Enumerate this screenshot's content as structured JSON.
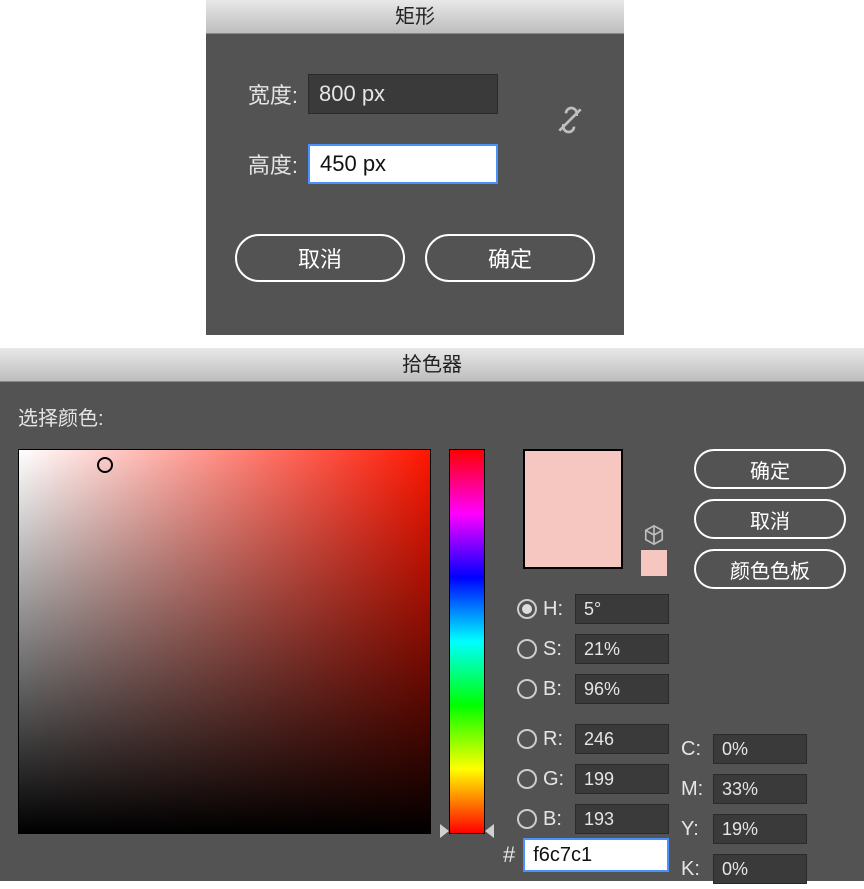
{
  "rect_dialog": {
    "title": "矩形",
    "width_label": "宽度:",
    "width_value": "800 px",
    "height_label": "高度:",
    "height_value": "450 px",
    "cancel": "取消",
    "ok": "确定"
  },
  "color_picker": {
    "title": "拾色器",
    "select_label": "选择颜色:",
    "ok": "确定",
    "cancel": "取消",
    "swatches": "颜色色板",
    "swatch_hex": "#f6c7c1",
    "hsb": {
      "h_label": "H:",
      "h_value": "5°",
      "s_label": "S:",
      "s_value": "21%",
      "b_label": "B:",
      "b_value": "96%",
      "selected": "H"
    },
    "rgb": {
      "r_label": "R:",
      "r_value": "246",
      "g_label": "G:",
      "g_value": "199",
      "b_label": "B:",
      "b_value": "193"
    },
    "cmyk": {
      "c_label": "C:",
      "c_value": "0%",
      "m_label": "M:",
      "m_value": "33%",
      "y_label": "Y:",
      "y_value": "19%",
      "k_label": "K:",
      "k_value": "0%"
    },
    "hex_label": "#",
    "hex_value": "f6c7c1",
    "sv_cursor": {
      "x_pct": 21,
      "y_pct": 4
    }
  }
}
